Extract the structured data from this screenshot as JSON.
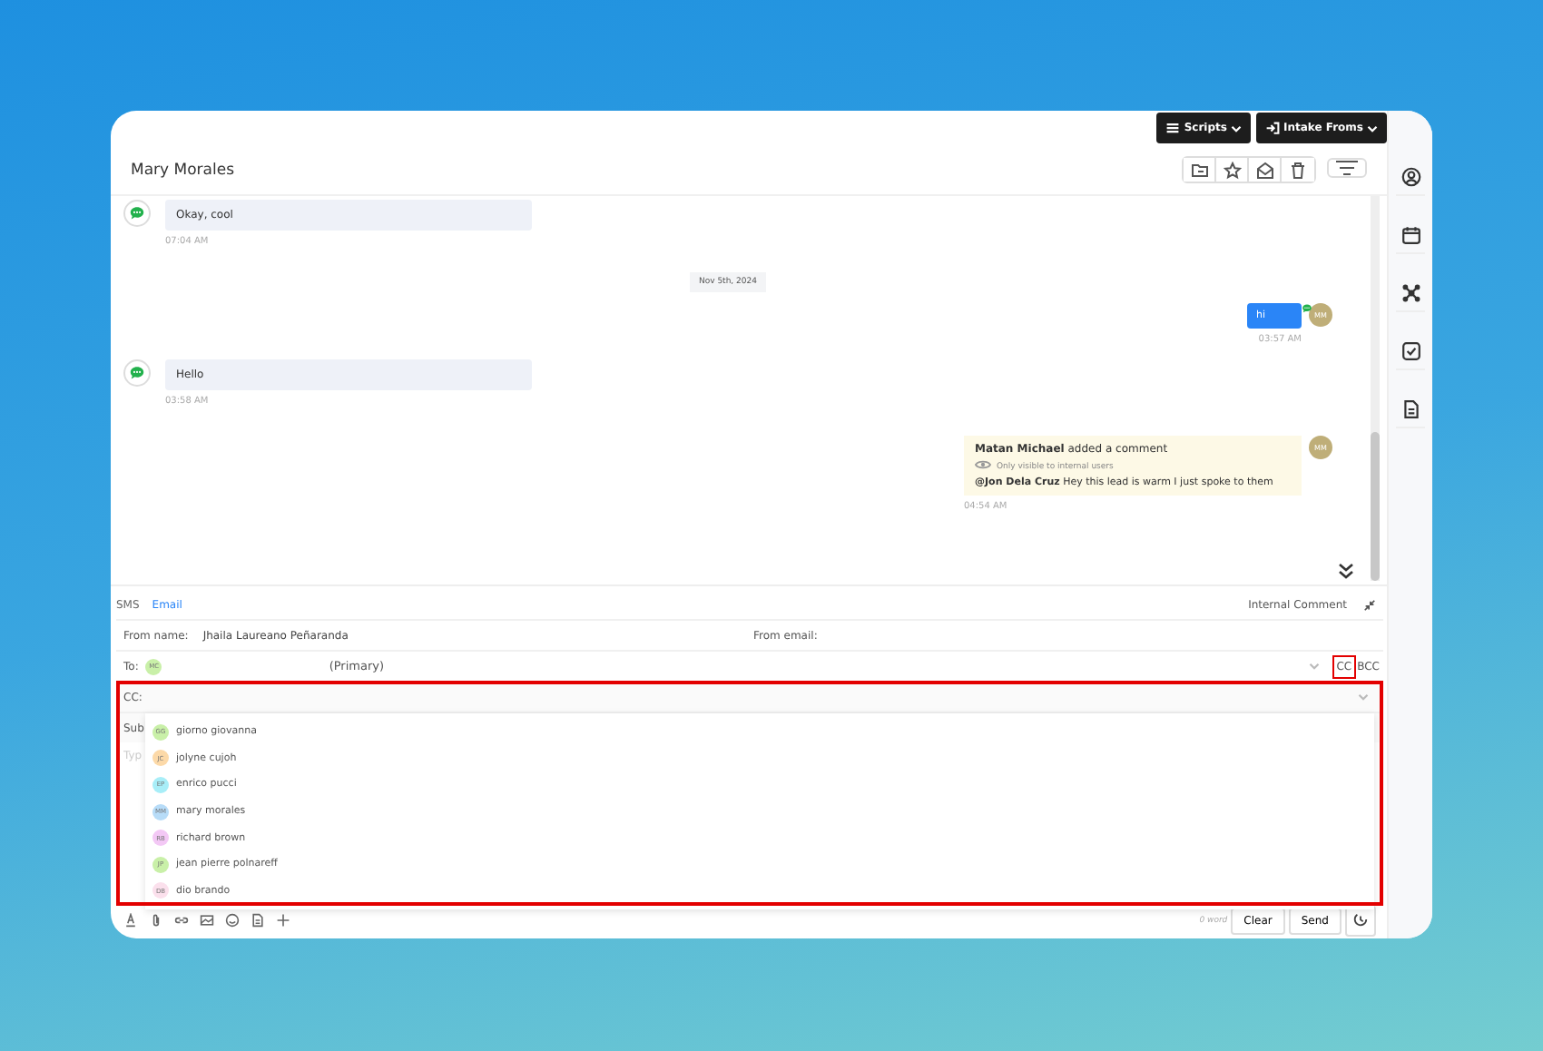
{
  "top_buttons": [
    "Scripts",
    "Intake Froms"
  ],
  "header": {
    "title": "Mary Morales"
  },
  "messages": [
    {
      "kind": "incoming",
      "text": "Okay, cool",
      "time": "07:04 AM"
    },
    {
      "kind": "date",
      "text": "Nov 5th, 2024"
    },
    {
      "kind": "outgoing",
      "text": "hi",
      "time": "03:57 AM",
      "avatar": "MM"
    },
    {
      "kind": "incoming",
      "text": "Hello",
      "time": "03:58 AM"
    },
    {
      "kind": "comment",
      "author": "Matan Michael",
      "action": "added a comment",
      "note": "Only visible to internal users",
      "text": "**@Jon Dela Cruz** Hey this lead is warm I just spoke to them",
      "time": "04:54 AM",
      "avatar": "MM"
    }
  ],
  "composer": {
    "tabs": [
      {
        "label": "SMS",
        "selected": false
      },
      {
        "label": "Email",
        "selected": true
      }
    ],
    "internal_comment": "Internal Comment",
    "from_name_label": "From name:",
    "from_name": "Jhaila Laureano  Peñaranda",
    "from_email_label": "From email:",
    "to_label": "To:",
    "to_avatar": "MC",
    "to_value": "(Primary)",
    "cc_toggle": {
      "label": "CC",
      "highlighted": true
    },
    "bcc_label": "BCC",
    "cc_label": "CC:",
    "cc_highlighted": true,
    "subject_label": "Sub",
    "body_placeholder": "Typ",
    "suggestions": [
      {
        "initials": "GG",
        "name": "giorno giovanna",
        "color": "#c9f0a8"
      },
      {
        "initials": "JC",
        "name": "jolyne cujoh",
        "color": "#fcd9a8"
      },
      {
        "initials": "EP",
        "name": "enrico pucci",
        "color": "#a8eef8"
      },
      {
        "initials": "MM",
        "name": "mary morales",
        "color": "#b7dcf8"
      },
      {
        "initials": "RB",
        "name": "richard brown",
        "color": "#f3c8f5"
      },
      {
        "initials": "JP",
        "name": "jean pierre polnareff",
        "color": "#c9f0a8"
      },
      {
        "initials": "DB",
        "name": "dio brando",
        "color": "#fbe0ec"
      }
    ],
    "word_count": "0 word",
    "buttons": [
      "Clear",
      "Send"
    ]
  }
}
